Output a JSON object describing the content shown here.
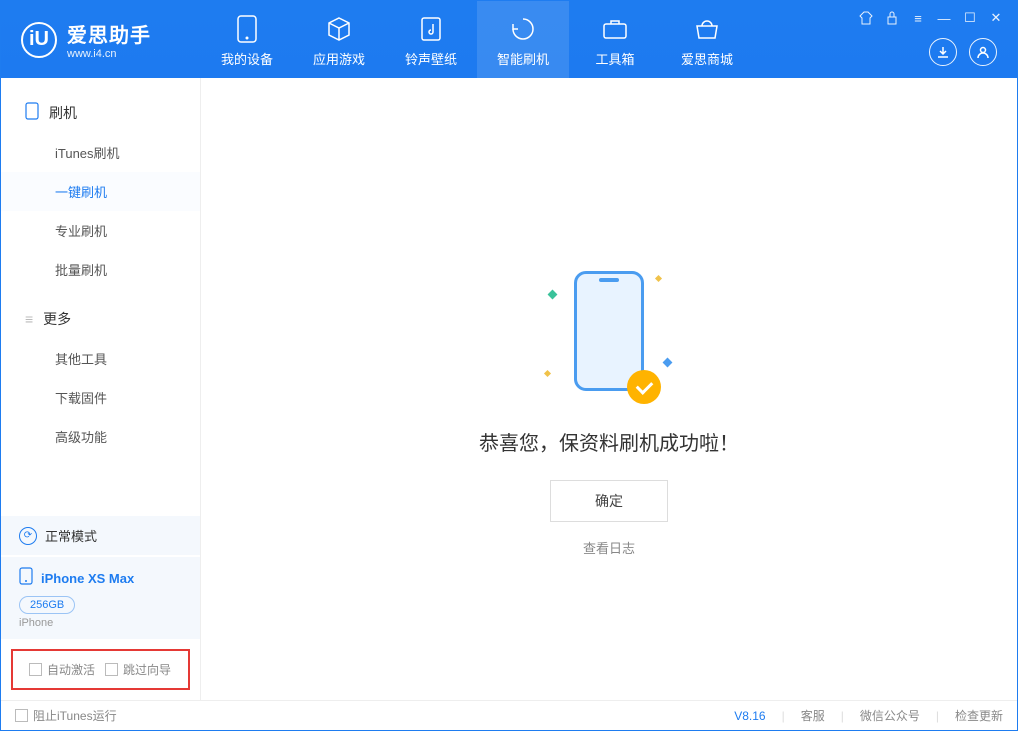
{
  "app": {
    "title": "爱思助手",
    "subtitle": "www.i4.cn"
  },
  "nav": {
    "tabs": [
      {
        "label": "我的设备"
      },
      {
        "label": "应用游戏"
      },
      {
        "label": "铃声壁纸"
      },
      {
        "label": "智能刷机"
      },
      {
        "label": "工具箱"
      },
      {
        "label": "爱思商城"
      }
    ]
  },
  "sidebar": {
    "group1": "刷机",
    "items1": [
      {
        "label": "iTunes刷机"
      },
      {
        "label": "一键刷机"
      },
      {
        "label": "专业刷机"
      },
      {
        "label": "批量刷机"
      }
    ],
    "group2": "更多",
    "items2": [
      {
        "label": "其他工具"
      },
      {
        "label": "下载固件"
      },
      {
        "label": "高级功能"
      }
    ],
    "mode": "正常模式",
    "device": {
      "name": "iPhone XS Max",
      "capacity": "256GB",
      "type": "iPhone"
    },
    "chk1": "自动激活",
    "chk2": "跳过向导"
  },
  "main": {
    "success": "恭喜您，保资料刷机成功啦！",
    "ok": "确定",
    "log": "查看日志"
  },
  "footer": {
    "block_itunes": "阻止iTunes运行",
    "version": "V8.16",
    "links": [
      "客服",
      "微信公众号",
      "检查更新"
    ]
  }
}
